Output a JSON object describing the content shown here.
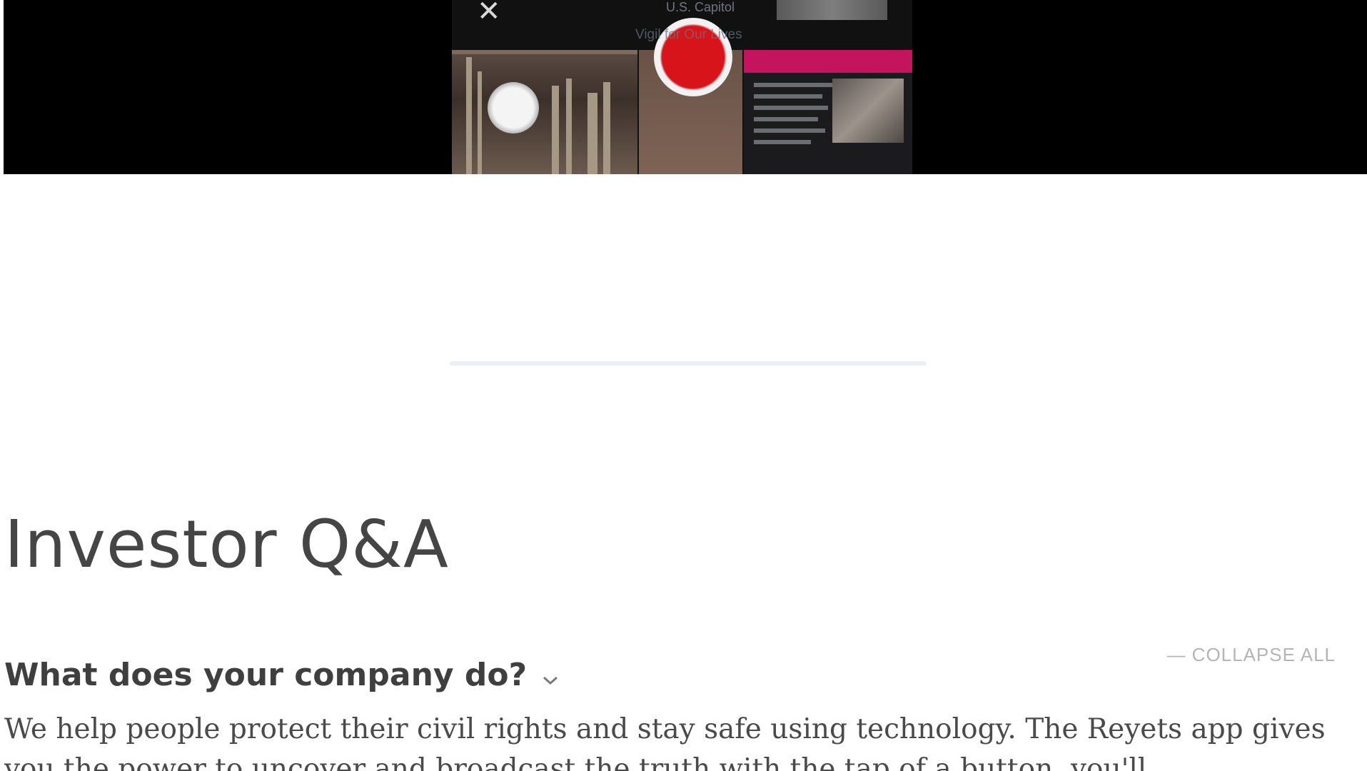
{
  "video": {
    "caption_top": "U.S. Capitol",
    "caption_sub": "Vigil for Our Lives",
    "close_icon": "close-icon"
  },
  "section": {
    "title": "Investor Q&A",
    "collapse_all_label": "— COLLAPSE ALL"
  },
  "faq": [
    {
      "question": "What does your company do?",
      "expand_icon": "chevron-down-icon",
      "answer": "We help people protect their civil rights and stay safe using technology. The Reyets app gives you the power to uncover and broadcast the truth with the tap of a button, you'll"
    }
  ],
  "colors": {
    "banner_bg": "#000000",
    "record_red": "#d8141b",
    "accent_pink": "#c5145e",
    "divider": "#e9f0f4",
    "heading": "#454545",
    "muted": "#b5b5b5"
  }
}
